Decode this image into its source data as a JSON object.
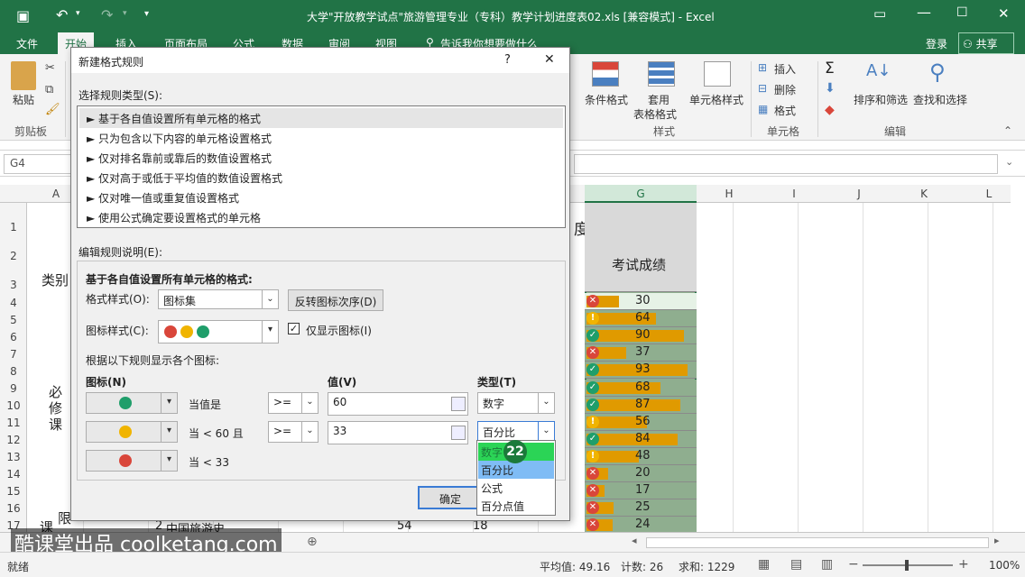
{
  "window": {
    "title": "大学\"开放教学试点\"旅游管理专业（专科）教学计划进度表02.xls  [兼容模式] - Excel"
  },
  "ribbon": {
    "tabs": [
      "文件",
      "开始",
      "插入",
      "页面布局",
      "公式",
      "数据",
      "审阅",
      "视图"
    ],
    "search_hint": "告诉我你想要做什么",
    "login": "登录",
    "share": "共享",
    "paste": "粘贴",
    "clipboard_group": "剪贴板",
    "cond_format": "条件格式",
    "table_format": "套用\n表格格式",
    "table_format_1": "套用",
    "table_format_2": "表格格式",
    "cell_styles": "单元格样式",
    "styles_group": "样式",
    "insert": "插入",
    "delete": "删除",
    "format": "格式",
    "cells_group": "单元格",
    "sort_filter": "排序和筛选",
    "find_select": "查找和选择",
    "editing_group": "编辑"
  },
  "formula_bar": {
    "name_box": "G4"
  },
  "columns": [
    "A",
    "G",
    "H",
    "I",
    "J",
    "K",
    "L"
  ],
  "rows": [
    "1",
    "2",
    "3",
    "4",
    "5",
    "6",
    "7",
    "8",
    "9",
    "10",
    "11",
    "12",
    "13",
    "14",
    "15",
    "16",
    "17"
  ],
  "sheet_text": {
    "title_frag": "度表",
    "col_a_r3": "类别",
    "col_a_bi": "必",
    "col_a_xiu": "修",
    "col_a_ke": "课",
    "col_a_xian": "限",
    "col_a_ke2": "课",
    "g_header": "考试成绩",
    "r17_num": "2",
    "r17_course": "中国旅游史",
    "r17_v1": "54",
    "r17_v2": "18"
  },
  "scores": [
    {
      "v": 30,
      "icon": "bad"
    },
    {
      "v": 64,
      "icon": "warn"
    },
    {
      "v": 90,
      "icon": "ok"
    },
    {
      "v": 37,
      "icon": "bad"
    },
    {
      "v": 93,
      "icon": "ok"
    },
    {
      "v": 68,
      "icon": "ok"
    },
    {
      "v": 87,
      "icon": "ok"
    },
    {
      "v": 56,
      "icon": "warn"
    },
    {
      "v": 84,
      "icon": "ok"
    },
    {
      "v": 48,
      "icon": "warn"
    },
    {
      "v": 20,
      "icon": "bad"
    },
    {
      "v": 17,
      "icon": "bad"
    },
    {
      "v": 25,
      "icon": "bad"
    },
    {
      "v": 24,
      "icon": "bad"
    }
  ],
  "dialog": {
    "title": "新建格式规则",
    "help": "?",
    "close": "✕",
    "rule_type_label": "选择规则类型(S):",
    "rule_types": [
      "► 基于各自值设置所有单元格的格式",
      "► 只为包含以下内容的单元格设置格式",
      "► 仅对排名靠前或靠后的数值设置格式",
      "► 仅对高于或低于平均值的数值设置格式",
      "► 仅对唯一值或重复值设置格式",
      "► 使用公式确定要设置格式的单元格"
    ],
    "edit_label": "编辑规则说明(E):",
    "section_title": "基于各自值设置所有单元格的格式:",
    "format_style_label": "格式样式(O):",
    "format_style_value": "图标集",
    "reverse_btn": "反转图标次序(D)",
    "icon_style_label": "图标样式(C):",
    "show_icon_only": "仅显示图标(I)",
    "rules_hint": "根据以下规则显示各个图标:",
    "col_icon": "图标(N)",
    "col_value": "值(V)",
    "col_type": "类型(T)",
    "rule1_text": "当值是",
    "rule1_op": ">=",
    "rule1_value": "60",
    "rule1_type": "数字",
    "rule2_text": "当 < 60 且",
    "rule2_op": ">=",
    "rule2_value": "33",
    "rule2_type": "百分比",
    "rule3_text": "当 < 33",
    "ok": "确定"
  },
  "type_dropdown": {
    "options": [
      "数字",
      "百分比",
      "公式",
      "百分点值"
    ],
    "highlighted": "百分比"
  },
  "step_badge": "22",
  "watermark": "酷课堂出品 coolketang.com",
  "status": {
    "ready": "就绪",
    "average": "平均值: 49.16",
    "count": "计数: 26",
    "sum": "求和: 1229",
    "zoom": "100%"
  },
  "colors": {
    "excel_green": "#217346",
    "icon_ok": "#1f9e6a",
    "icon_bad": "#d9463a",
    "icon_warn": "#f0b400",
    "databar": "#e09a00"
  }
}
